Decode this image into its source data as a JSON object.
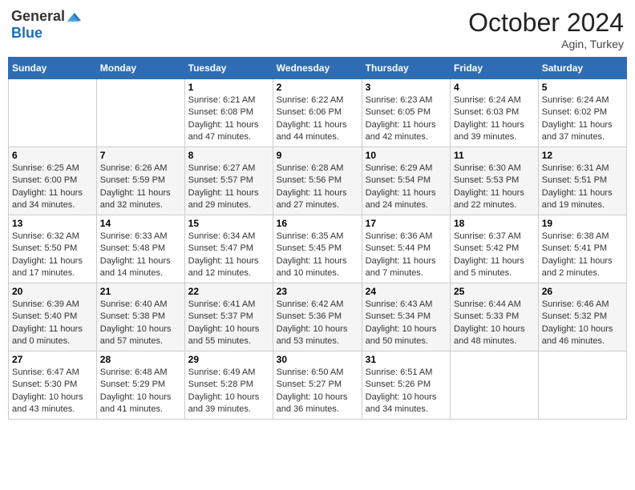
{
  "header": {
    "logo_general": "General",
    "logo_blue": "Blue",
    "month": "October 2024",
    "location": "Agin, Turkey"
  },
  "days_of_week": [
    "Sunday",
    "Monday",
    "Tuesday",
    "Wednesday",
    "Thursday",
    "Friday",
    "Saturday"
  ],
  "weeks": [
    [
      {
        "day": "",
        "info": ""
      },
      {
        "day": "",
        "info": ""
      },
      {
        "day": "1",
        "sunrise": "Sunrise: 6:21 AM",
        "sunset": "Sunset: 6:08 PM",
        "daylight": "Daylight: 11 hours and 47 minutes."
      },
      {
        "day": "2",
        "sunrise": "Sunrise: 6:22 AM",
        "sunset": "Sunset: 6:06 PM",
        "daylight": "Daylight: 11 hours and 44 minutes."
      },
      {
        "day": "3",
        "sunrise": "Sunrise: 6:23 AM",
        "sunset": "Sunset: 6:05 PM",
        "daylight": "Daylight: 11 hours and 42 minutes."
      },
      {
        "day": "4",
        "sunrise": "Sunrise: 6:24 AM",
        "sunset": "Sunset: 6:03 PM",
        "daylight": "Daylight: 11 hours and 39 minutes."
      },
      {
        "day": "5",
        "sunrise": "Sunrise: 6:24 AM",
        "sunset": "Sunset: 6:02 PM",
        "daylight": "Daylight: 11 hours and 37 minutes."
      }
    ],
    [
      {
        "day": "6",
        "sunrise": "Sunrise: 6:25 AM",
        "sunset": "Sunset: 6:00 PM",
        "daylight": "Daylight: 11 hours and 34 minutes."
      },
      {
        "day": "7",
        "sunrise": "Sunrise: 6:26 AM",
        "sunset": "Sunset: 5:59 PM",
        "daylight": "Daylight: 11 hours and 32 minutes."
      },
      {
        "day": "8",
        "sunrise": "Sunrise: 6:27 AM",
        "sunset": "Sunset: 5:57 PM",
        "daylight": "Daylight: 11 hours and 29 minutes."
      },
      {
        "day": "9",
        "sunrise": "Sunrise: 6:28 AM",
        "sunset": "Sunset: 5:56 PM",
        "daylight": "Daylight: 11 hours and 27 minutes."
      },
      {
        "day": "10",
        "sunrise": "Sunrise: 6:29 AM",
        "sunset": "Sunset: 5:54 PM",
        "daylight": "Daylight: 11 hours and 24 minutes."
      },
      {
        "day": "11",
        "sunrise": "Sunrise: 6:30 AM",
        "sunset": "Sunset: 5:53 PM",
        "daylight": "Daylight: 11 hours and 22 minutes."
      },
      {
        "day": "12",
        "sunrise": "Sunrise: 6:31 AM",
        "sunset": "Sunset: 5:51 PM",
        "daylight": "Daylight: 11 hours and 19 minutes."
      }
    ],
    [
      {
        "day": "13",
        "sunrise": "Sunrise: 6:32 AM",
        "sunset": "Sunset: 5:50 PM",
        "daylight": "Daylight: 11 hours and 17 minutes."
      },
      {
        "day": "14",
        "sunrise": "Sunrise: 6:33 AM",
        "sunset": "Sunset: 5:48 PM",
        "daylight": "Daylight: 11 hours and 14 minutes."
      },
      {
        "day": "15",
        "sunrise": "Sunrise: 6:34 AM",
        "sunset": "Sunset: 5:47 PM",
        "daylight": "Daylight: 11 hours and 12 minutes."
      },
      {
        "day": "16",
        "sunrise": "Sunrise: 6:35 AM",
        "sunset": "Sunset: 5:45 PM",
        "daylight": "Daylight: 11 hours and 10 minutes."
      },
      {
        "day": "17",
        "sunrise": "Sunrise: 6:36 AM",
        "sunset": "Sunset: 5:44 PM",
        "daylight": "Daylight: 11 hours and 7 minutes."
      },
      {
        "day": "18",
        "sunrise": "Sunrise: 6:37 AM",
        "sunset": "Sunset: 5:42 PM",
        "daylight": "Daylight: 11 hours and 5 minutes."
      },
      {
        "day": "19",
        "sunrise": "Sunrise: 6:38 AM",
        "sunset": "Sunset: 5:41 PM",
        "daylight": "Daylight: 11 hours and 2 minutes."
      }
    ],
    [
      {
        "day": "20",
        "sunrise": "Sunrise: 6:39 AM",
        "sunset": "Sunset: 5:40 PM",
        "daylight": "Daylight: 11 hours and 0 minutes."
      },
      {
        "day": "21",
        "sunrise": "Sunrise: 6:40 AM",
        "sunset": "Sunset: 5:38 PM",
        "daylight": "Daylight: 10 hours and 57 minutes."
      },
      {
        "day": "22",
        "sunrise": "Sunrise: 6:41 AM",
        "sunset": "Sunset: 5:37 PM",
        "daylight": "Daylight: 10 hours and 55 minutes."
      },
      {
        "day": "23",
        "sunrise": "Sunrise: 6:42 AM",
        "sunset": "Sunset: 5:36 PM",
        "daylight": "Daylight: 10 hours and 53 minutes."
      },
      {
        "day": "24",
        "sunrise": "Sunrise: 6:43 AM",
        "sunset": "Sunset: 5:34 PM",
        "daylight": "Daylight: 10 hours and 50 minutes."
      },
      {
        "day": "25",
        "sunrise": "Sunrise: 6:44 AM",
        "sunset": "Sunset: 5:33 PM",
        "daylight": "Daylight: 10 hours and 48 minutes."
      },
      {
        "day": "26",
        "sunrise": "Sunrise: 6:46 AM",
        "sunset": "Sunset: 5:32 PM",
        "daylight": "Daylight: 10 hours and 46 minutes."
      }
    ],
    [
      {
        "day": "27",
        "sunrise": "Sunrise: 6:47 AM",
        "sunset": "Sunset: 5:30 PM",
        "daylight": "Daylight: 10 hours and 43 minutes."
      },
      {
        "day": "28",
        "sunrise": "Sunrise: 6:48 AM",
        "sunset": "Sunset: 5:29 PM",
        "daylight": "Daylight: 10 hours and 41 minutes."
      },
      {
        "day": "29",
        "sunrise": "Sunrise: 6:49 AM",
        "sunset": "Sunset: 5:28 PM",
        "daylight": "Daylight: 10 hours and 39 minutes."
      },
      {
        "day": "30",
        "sunrise": "Sunrise: 6:50 AM",
        "sunset": "Sunset: 5:27 PM",
        "daylight": "Daylight: 10 hours and 36 minutes."
      },
      {
        "day": "31",
        "sunrise": "Sunrise: 6:51 AM",
        "sunset": "Sunset: 5:26 PM",
        "daylight": "Daylight: 10 hours and 34 minutes."
      },
      {
        "day": "",
        "info": ""
      },
      {
        "day": "",
        "info": ""
      }
    ]
  ]
}
